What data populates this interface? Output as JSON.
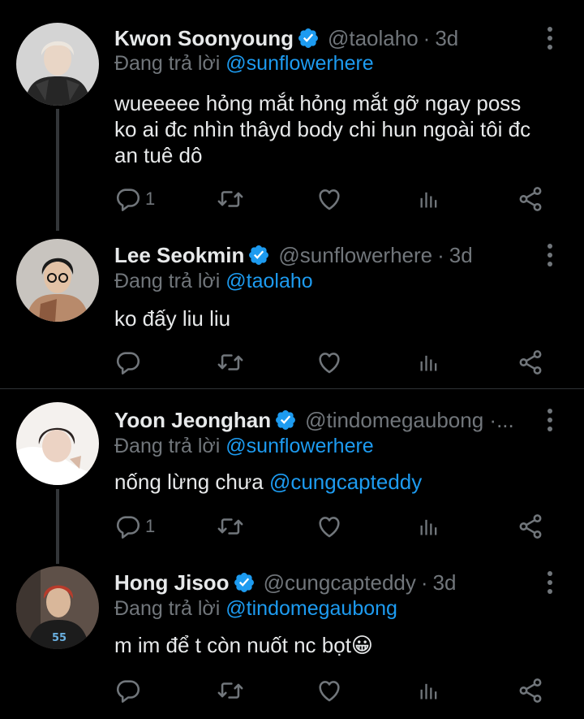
{
  "reply_prefix": "Đang trả lời",
  "tweets": [
    {
      "name": "Kwon Soonyoung",
      "handle": "@taolaho",
      "time": "3d",
      "reply_to": "@sunflowerhere",
      "text_lines": [
        "wueeeee hỏng mắt hỏng mắt gỡ ngay poss",
        "ko ai đc nhìn thâyd body chi hun ngoài tôi đc",
        "an tuê dô"
      ],
      "reply_count": "1",
      "avatar_colors": {
        "bg": "#d8d8d8",
        "hair": "#e8e2da",
        "shirt": "#2a2a2a"
      }
    },
    {
      "name": "Lee Seokmin",
      "handle": "@sunflowerhere",
      "time": "3d",
      "reply_to": "@taolaho",
      "text_main": "ko đấy liu liu",
      "text_mention": "",
      "reply_count": "",
      "avatar_colors": {
        "bg": "#c9c6c2",
        "hair": "#1a1a1a",
        "shirt": "#b8896a"
      }
    },
    {
      "name": "Yoon Jeonghan",
      "handle": "@tindomegaubong ·...",
      "time": "",
      "reply_to": "@sunflowerhere",
      "text_main": "nống lừng chưa ",
      "text_mention": "@cungcapteddy",
      "reply_count": "1",
      "avatar_colors": {
        "bg": "#f2eeea",
        "hair": "#2b2321",
        "shirt": "#ffffff"
      }
    },
    {
      "name": "Hong Jisoo",
      "handle": "@cungcapteddy",
      "time": "3d",
      "reply_to": "@tindomegaubong",
      "text_main": "m im để t còn nuốt nc bọt😀",
      "text_mention": "",
      "reply_count": "",
      "avatar_colors": {
        "bg": "#6b5a4e",
        "hair": "#c0392b",
        "shirt": "#1e1e1e"
      }
    }
  ],
  "colors": {
    "background": "#000000",
    "text": "#e7e9ea",
    "muted": "#71767b",
    "accent": "#1d9bf0",
    "divider": "#2f3336"
  },
  "icons": {
    "reply": "reply-icon",
    "retweet": "retweet-icon",
    "like": "heart-icon",
    "views": "views-bar-icon",
    "share": "share-icon",
    "more": "more-vertical-icon",
    "verified": "verified-badge-icon"
  }
}
